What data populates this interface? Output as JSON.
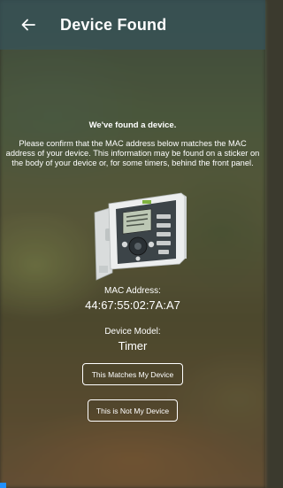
{
  "header": {
    "title": "Device Found",
    "back_icon": "arrow-left-icon"
  },
  "message": {
    "lead": "We've found a device.",
    "description": "Please confirm that the MAC address below matches the MAC address of your device. This information may be found on a sticker on the body of your device or, for some timers, behind the front panel."
  },
  "device": {
    "image_icon": "timer-controller-image",
    "mac_label": "MAC Address:",
    "mac_value": "44:67:55:02:7A:A7",
    "model_label": "Device Model:",
    "model_value": "Timer"
  },
  "actions": {
    "match_label": "This Matches My Device",
    "not_mine_label": "This is Not My Device"
  },
  "colors": {
    "header_bg": "#345460",
    "accent": "#1f8fff",
    "text": "#ffffff"
  }
}
